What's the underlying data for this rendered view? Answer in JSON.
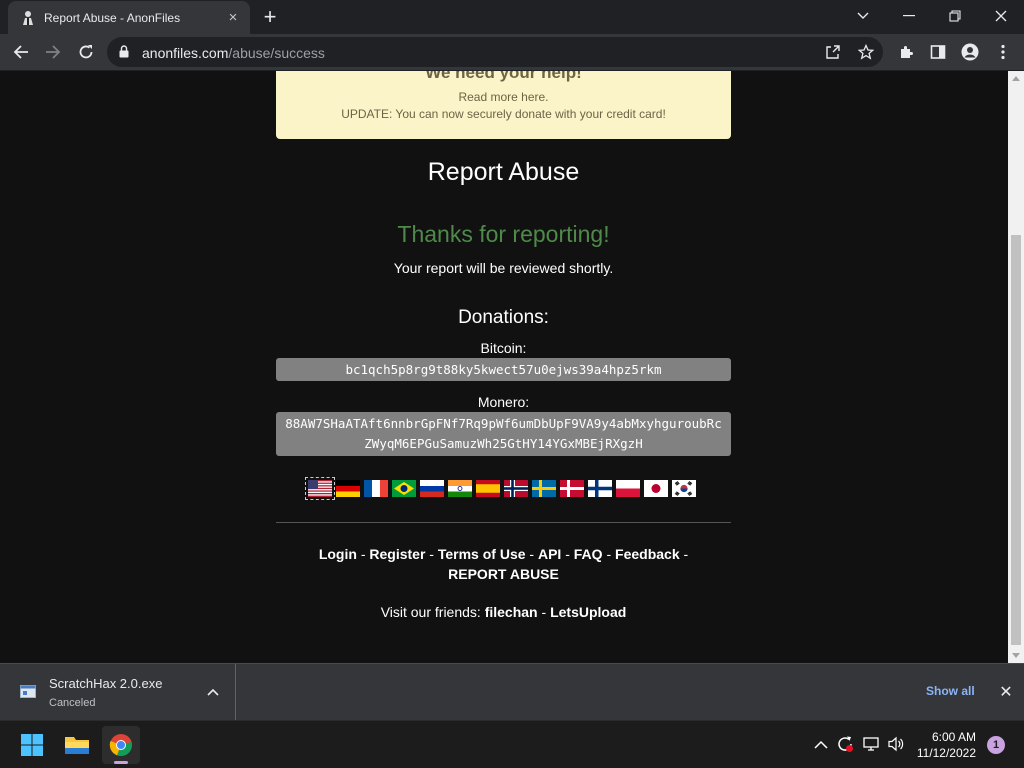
{
  "browser": {
    "tab": {
      "title": "Report Abuse - AnonFiles",
      "close_icon": "×"
    },
    "new_tab_icon": "+",
    "address": {
      "host": "anonfiles.com",
      "path": "/abuse/success"
    }
  },
  "page": {
    "notice": {
      "heading": "We need your help!",
      "line1": "Read more here.",
      "line2": "UPDATE: You can now securely donate with your credit card!"
    },
    "title": "Report Abuse",
    "thanks": "Thanks for reporting!",
    "review": "Your report will be reviewed shortly.",
    "donations_title": "Donations:",
    "bitcoin_label": "Bitcoin:",
    "bitcoin_address": "bc1qch5p8rg9t88ky5kwect57u0ejws39a4hpz5rkm",
    "monero_label": "Monero:",
    "monero_address": "88AW7SHaATAft6nnbrGpFNf7Rq9pWf6umDbUpF9VA9y4abMxyhguroubRcZWyqM6EPGuSamuzWh25GtHY14YGxMBEjRXgzH",
    "monero_line1": "88AW7SHaATAft6nnbrGpFNf7Rq9pWf6umDbUpF9VA9y4abMxyhguroubRc",
    "monero_line2": "ZWyqM6EPGuSamuzWh25GtHY14YGxMBEjRXgzH",
    "flags": [
      "us",
      "de",
      "fr",
      "br",
      "ru",
      "in",
      "es",
      "no",
      "se",
      "dk",
      "fi",
      "pl",
      "jp",
      "kr"
    ],
    "footer": {
      "login": "Login",
      "register": "Register",
      "terms": "Terms of Use",
      "api": "API",
      "faq": "FAQ",
      "feedback": "Feedback",
      "report": "REPORT ABUSE",
      "sep": "-"
    },
    "friends": {
      "prefix": "Visit our friends:",
      "filechan": "filechan",
      "letsupload": "LetsUpload",
      "sep": "-"
    }
  },
  "downloads": {
    "item": {
      "name": "ScratchHax 2.0.exe",
      "status": "Canceled"
    },
    "show_all": "Show all",
    "close_icon": "✕"
  },
  "taskbar": {
    "time": "6:00 AM",
    "date": "11/12/2022",
    "notifications": "1"
  },
  "colors": {
    "thanks": "#4f8a4a",
    "notice_bg": "#fbf4c8",
    "address_bg": "#818181",
    "show_all": "#8ab4f8"
  }
}
